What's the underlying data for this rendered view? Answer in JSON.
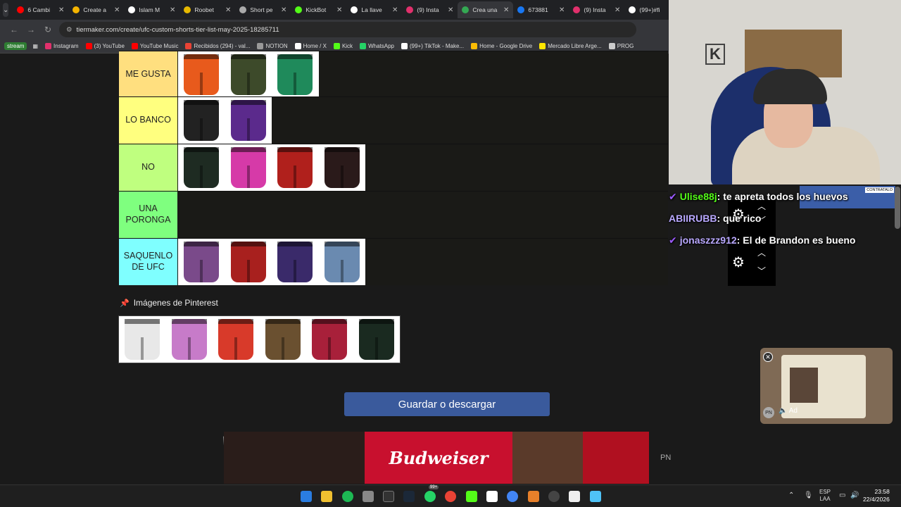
{
  "browser": {
    "tabs": [
      {
        "label": "6 Cambi",
        "color": "#ff0000"
      },
      {
        "label": "Create a",
        "color": "#f4b400"
      },
      {
        "label": "Islam M",
        "color": "#ffffff"
      },
      {
        "label": "Roobet",
        "color": "#e7b900"
      },
      {
        "label": "Short pe",
        "color": "#aaaaaa"
      },
      {
        "label": "KickBot",
        "color": "#53fc18"
      },
      {
        "label": "La llave",
        "color": "#ffffff"
      },
      {
        "label": "(9) Insta",
        "color": "#e1306c"
      },
      {
        "label": "Crea una",
        "color": "#34a853",
        "active": true
      },
      {
        "label": "673881",
        "color": "#1877f2"
      },
      {
        "label": "(9) Insta",
        "color": "#e1306c"
      },
      {
        "label": "(99+)#fi",
        "color": "#ffffff"
      }
    ],
    "url": "tiermaker.com/create/ufc-custom-shorts-tier-list-may-2025-18285711",
    "bookmarks": [
      {
        "label": "Instagram",
        "color": "#e1306c"
      },
      {
        "label": "(3) YouTube",
        "color": "#ff0000"
      },
      {
        "label": "YouTube Music",
        "color": "#ff0000"
      },
      {
        "label": "Recibidos (294) - val...",
        "color": "#ea4335"
      },
      {
        "label": "NOTION",
        "color": "#999999"
      },
      {
        "label": "Home / X",
        "color": "#ffffff"
      },
      {
        "label": "Kick",
        "color": "#53fc18"
      },
      {
        "label": "WhatsApp",
        "color": "#25d366"
      },
      {
        "label": "(99+) TikTok - Make...",
        "color": "#ffffff"
      },
      {
        "label": "Home - Google Drive",
        "color": "#fbbc04"
      },
      {
        "label": "Mercado Libre Arge...",
        "color": "#ffe600"
      },
      {
        "label": "PROG",
        "color": "#cccccc"
      }
    ],
    "stream_chip": "stream"
  },
  "tiers": [
    {
      "label": "ME GUSTA",
      "color": "#ffdf7f",
      "items": [
        {
          "name": "orange-short",
          "color": "#e85a1c"
        },
        {
          "name": "camo-short",
          "color": "#3d4a2a"
        },
        {
          "name": "green-short",
          "color": "#1f8a5b"
        }
      ]
    },
    {
      "label": "LO BANCO",
      "color": "#ffff7f",
      "items": [
        {
          "name": "black-short",
          "color": "#222222"
        },
        {
          "name": "purple-short",
          "color": "#5b2a8c"
        }
      ]
    },
    {
      "label": "NO",
      "color": "#bfff7f",
      "items": [
        {
          "name": "black-green-short",
          "color": "#1e2b22"
        },
        {
          "name": "pink-short",
          "color": "#d63aa8"
        },
        {
          "name": "red-short",
          "color": "#b0201c"
        },
        {
          "name": "black-red-short",
          "color": "#2a1a1a"
        }
      ]
    },
    {
      "label": "UNA PORONGA",
      "color": "#7fff7f",
      "items": []
    },
    {
      "label": "SAQUENLO DE UFC",
      "color": "#7fffff",
      "items": [
        {
          "name": "floral-short",
          "color": "#7a4a8a"
        },
        {
          "name": "red-gold-short",
          "color": "#a8201e"
        },
        {
          "name": "mexico-short",
          "color": "#3a2a6a"
        },
        {
          "name": "blue-red-short",
          "color": "#6a8ab0"
        }
      ]
    }
  ],
  "pinterest": {
    "title": "Imágenes de Pinterest",
    "items": [
      {
        "name": "white-black-short",
        "color": "#e8e8e8"
      },
      {
        "name": "floral-pink-short",
        "color": "#c77bc9"
      },
      {
        "name": "white-red-short",
        "color": "#d83a2a"
      },
      {
        "name": "camo-gold-short",
        "color": "#6a5030"
      },
      {
        "name": "red-black-short",
        "color": "#a8203a"
      },
      {
        "name": "black-green-short",
        "color": "#1a2a20"
      }
    ]
  },
  "save_button": "Guardar o descargar",
  "ad": {
    "brand": "Budweiser",
    "pn": "PN"
  },
  "chat": [
    {
      "user": "Ulise88j",
      "user_color": "#53fc18",
      "message": "te apreta todos los huevos",
      "badge": true
    },
    {
      "user": "ABIIRUBB",
      "user_color": "#b9a8ff",
      "message": "que rico",
      "badge": false
    },
    {
      "user": "jonaszzz912",
      "user_color": "#b9a8ff",
      "message": "El de Brandon es bueno",
      "badge": true
    }
  ],
  "promo_tag": "CONTRATALO",
  "popup": {
    "ad_label": "Ad",
    "pn": "PN"
  },
  "tray": {
    "lang": "ESP",
    "region": "LAA",
    "time": "23:58",
    "date": "22/4/2026"
  },
  "taskbar_badge": "99+"
}
